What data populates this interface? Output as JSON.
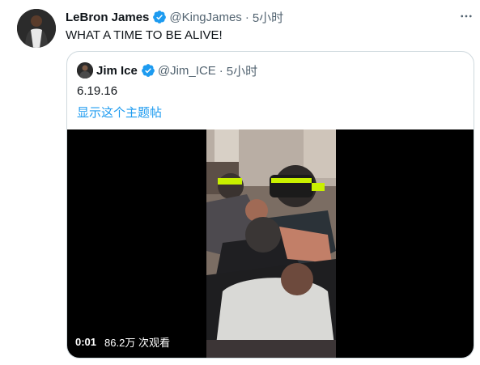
{
  "tweet": {
    "author_name": "LeBron James",
    "author_handle": "@KingJames",
    "separator": "·",
    "time": "5小时",
    "text": "WHAT A TIME TO BE ALIVE!",
    "more_icon": "more-horizontal-icon"
  },
  "quote": {
    "author_name": "Jim Ice",
    "author_handle": "@Jim_ICE",
    "separator": "·",
    "time": "5小时",
    "text": "6.19.16",
    "show_thread_label": "显示这个主题帖",
    "video": {
      "timestamp": "0:01",
      "views": "86.2万 次观看"
    }
  },
  "colors": {
    "verified": "#1d9bf0",
    "link": "#1d9bf0",
    "secondary_text": "#536471",
    "border": "#cfd9de"
  }
}
